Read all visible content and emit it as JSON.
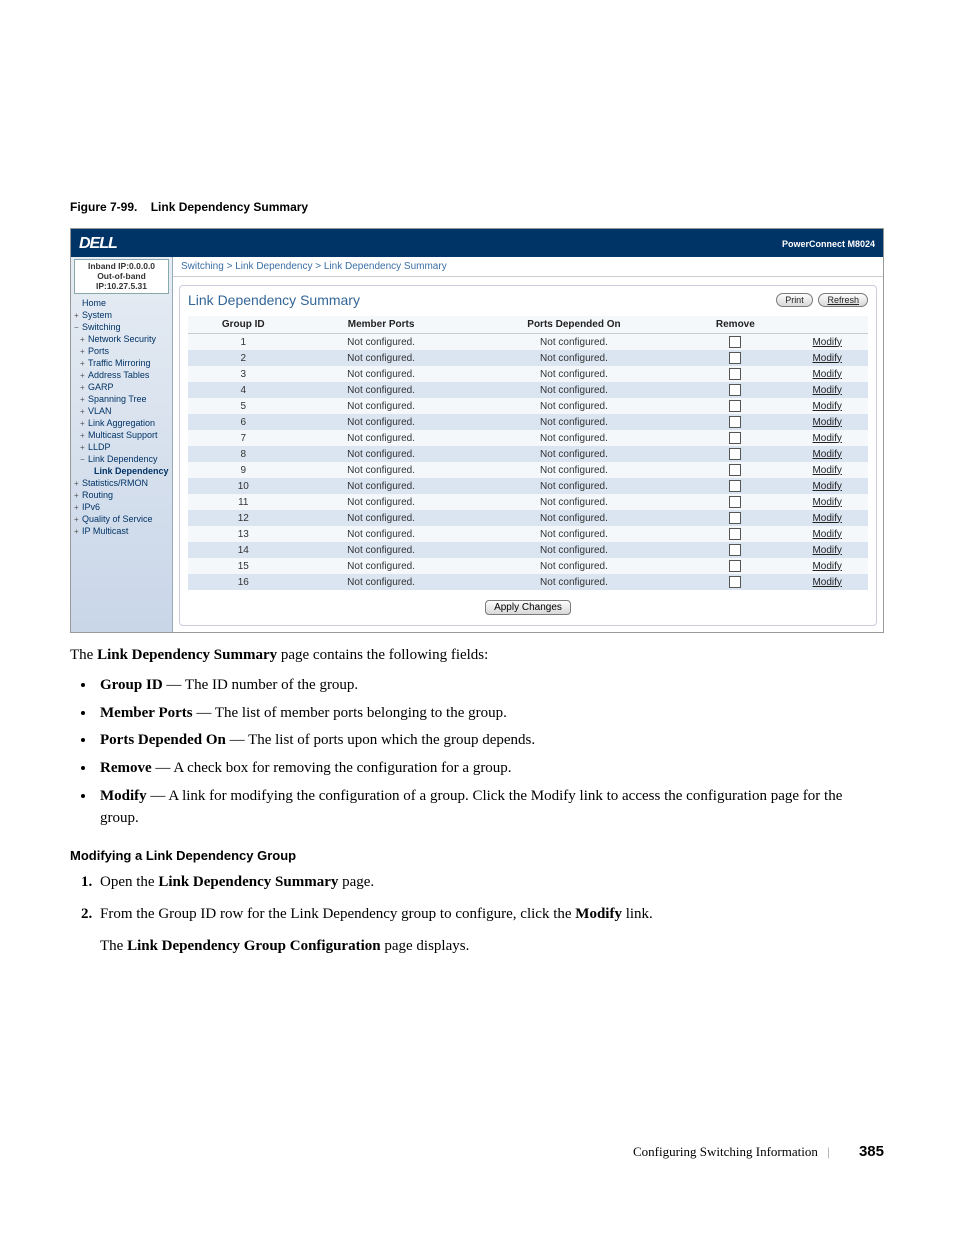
{
  "caption_prefix": "Figure 7-99.",
  "caption_text": "Link Dependency Summary",
  "header": {
    "logo": "DELL",
    "model": "PowerConnect M8024"
  },
  "sidebar": {
    "inband": "Inband IP:0.0.0.0",
    "outband": "Out-of-band IP:10.27.5.31",
    "items": [
      {
        "label": "Home",
        "expand": "",
        "level": 0
      },
      {
        "label": "System",
        "expand": "+",
        "level": 0
      },
      {
        "label": "Switching",
        "expand": "−",
        "level": 0
      },
      {
        "label": "Network Security",
        "expand": "+",
        "level": 1
      },
      {
        "label": "Ports",
        "expand": "+",
        "level": 1
      },
      {
        "label": "Traffic Mirroring",
        "expand": "+",
        "level": 1
      },
      {
        "label": "Address Tables",
        "expand": "+",
        "level": 1
      },
      {
        "label": "GARP",
        "expand": "+",
        "level": 1
      },
      {
        "label": "Spanning Tree",
        "expand": "+",
        "level": 1
      },
      {
        "label": "VLAN",
        "expand": "+",
        "level": 1
      },
      {
        "label": "Link Aggregation",
        "expand": "+",
        "level": 1
      },
      {
        "label": "Multicast Support",
        "expand": "+",
        "level": 1
      },
      {
        "label": "LLDP",
        "expand": "+",
        "level": 1
      },
      {
        "label": "Link Dependency",
        "expand": "−",
        "level": 1
      },
      {
        "label": "Link Dependency",
        "expand": "",
        "level": 2,
        "selected": true
      },
      {
        "label": "Statistics/RMON",
        "expand": "+",
        "level": 0
      },
      {
        "label": "Routing",
        "expand": "+",
        "level": 0
      },
      {
        "label": "IPv6",
        "expand": "+",
        "level": 0
      },
      {
        "label": "Quality of Service",
        "expand": "+",
        "level": 0
      },
      {
        "label": "IP Multicast",
        "expand": "+",
        "level": 0
      }
    ]
  },
  "breadcrumb": "Switching > Link Dependency > Link Dependency Summary",
  "content": {
    "title": "Link Dependency Summary",
    "print": "Print",
    "refresh": "Refresh",
    "columns": [
      "Group ID",
      "Member Ports",
      "Ports Depended On",
      "Remove",
      ""
    ],
    "not_configured": "Not configured.",
    "modify": "Modify",
    "row_count": 16,
    "apply": "Apply Changes"
  },
  "body": {
    "intro_pre": "The ",
    "intro_bold": "Link Dependency Summary",
    "intro_post": " page contains the following fields:",
    "bullets": [
      {
        "term": "Group ID",
        "desc": " — The ID number of the group."
      },
      {
        "term": "Member Ports",
        "desc": " — The list of member ports belonging to the group."
      },
      {
        "term": "Ports Depended On",
        "desc": " — The list of ports upon which the group depends."
      },
      {
        "term": "Remove",
        "desc": " — A check box for removing the configuration for a group."
      },
      {
        "term": "Modify",
        "desc": " — A link for modifying the configuration of a group. Click the Modify link to access the configuration page for the group."
      }
    ],
    "section_heading": "Modifying a Link Dependency Group",
    "step1_pre": "Open the ",
    "step1_bold": "Link Dependency Summary",
    "step1_post": " page.",
    "step2_pre": "From the Group ID row for the Link Dependency group to configure, click the ",
    "step2_bold": "Modify",
    "step2_post": " link.",
    "step2_note_pre": "The ",
    "step2_note_bold": "Link Dependency Group Configuration",
    "step2_note_post": " page displays."
  },
  "footer": {
    "text": "Configuring Switching Information",
    "page": "385"
  }
}
